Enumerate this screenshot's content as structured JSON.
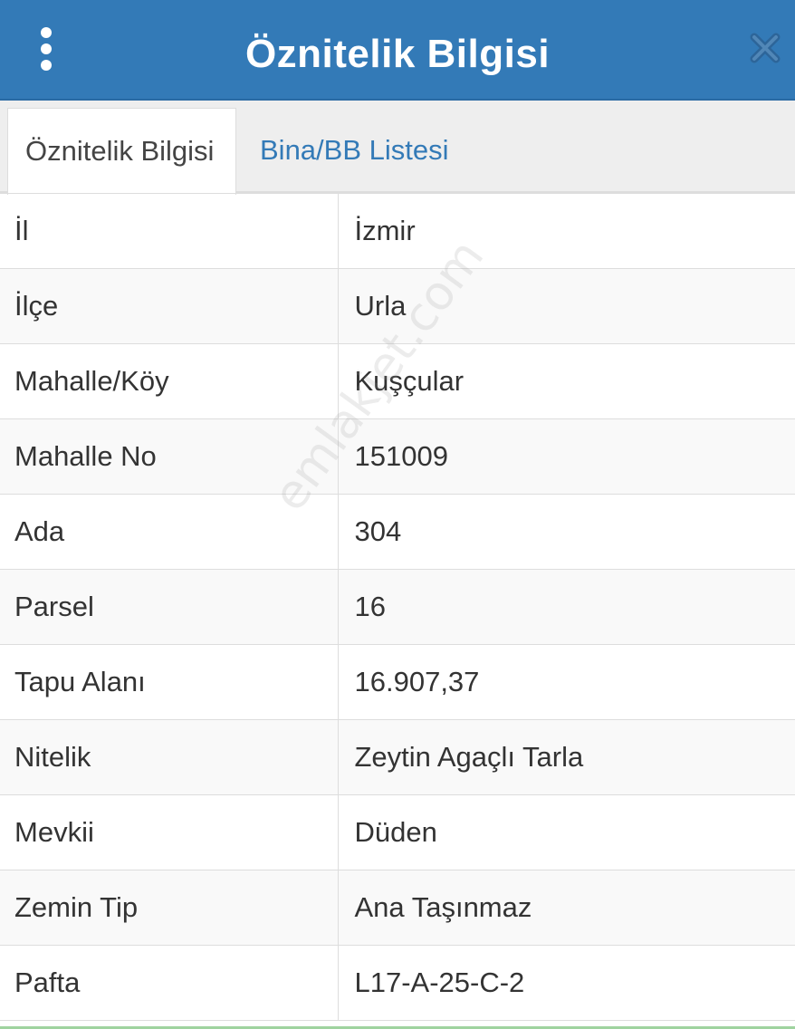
{
  "header": {
    "title": "Öznitelik Bilgisi",
    "menu_icon": "vertical-dots-icon",
    "close_icon": "close-icon",
    "background_color": "#337ab7"
  },
  "tabs": [
    {
      "label": "Öznitelik Bilgisi",
      "active": true
    },
    {
      "label": "Bina/BB Listesi",
      "active": false
    }
  ],
  "attributes": [
    {
      "label": "İl",
      "value": "İzmir"
    },
    {
      "label": "İlçe",
      "value": "Urla"
    },
    {
      "label": "Mahalle/Köy",
      "value": "Kuşçular"
    },
    {
      "label": "Mahalle No",
      "value": "151009"
    },
    {
      "label": "Ada",
      "value": "304"
    },
    {
      "label": "Parsel",
      "value": "16"
    },
    {
      "label": "Tapu Alanı",
      "value": "16.907,37"
    },
    {
      "label": "Nitelik",
      "value": "Zeytin Agaçlı Tarla"
    },
    {
      "label": "Mevkii",
      "value": "Düden"
    },
    {
      "label": "Zemin Tip",
      "value": "Ana Taşınmaz"
    },
    {
      "label": "Pafta",
      "value": "L17-A-25-C-2"
    }
  ],
  "watermark": "emlakjet.com"
}
